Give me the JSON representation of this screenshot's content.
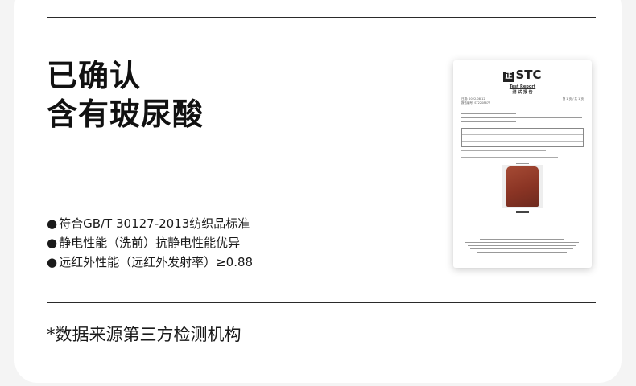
{
  "headline": {
    "line1": "已确认",
    "line2": "含有玻尿酸"
  },
  "bullets": [
    {
      "marker": "●",
      "text": "符合GB/T 30127-2013纺织品标准"
    },
    {
      "marker": "●",
      "text": "静电性能（洗前）抗静电性能优异"
    },
    {
      "marker": "●",
      "text": "远红外性能（远红外发射率）≥0.88"
    }
  ],
  "footnote": "*数据来源第三方检测机构",
  "report": {
    "logo_mark": "正",
    "logo_text": "STC",
    "title_en": "Test Report",
    "title_cn": "测 试 报 告",
    "meta_date": "日期: 2022-08-12",
    "meta_no": "报告编号: ST2208677",
    "page": "第 1 页 / 共 1 页"
  }
}
